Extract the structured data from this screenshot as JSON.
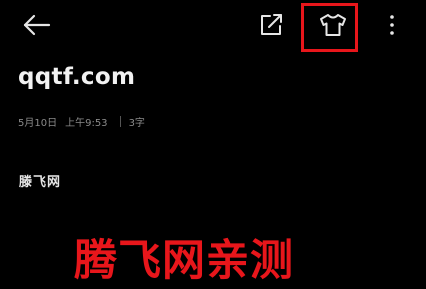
{
  "toolbar": {
    "back_icon": "arrow-left-icon",
    "share_icon": "share-export-icon",
    "theme_icon": "tshirt-icon",
    "more_icon": "more-vertical-icon",
    "highlight_color": "#e8161b"
  },
  "note": {
    "title": "qqtf.com",
    "date": "5月10日",
    "time": "上午9:53",
    "word_count": "3字",
    "body": "滕飞网"
  },
  "watermark": {
    "text": "腾飞网亲测",
    "color": "#e8161b"
  }
}
